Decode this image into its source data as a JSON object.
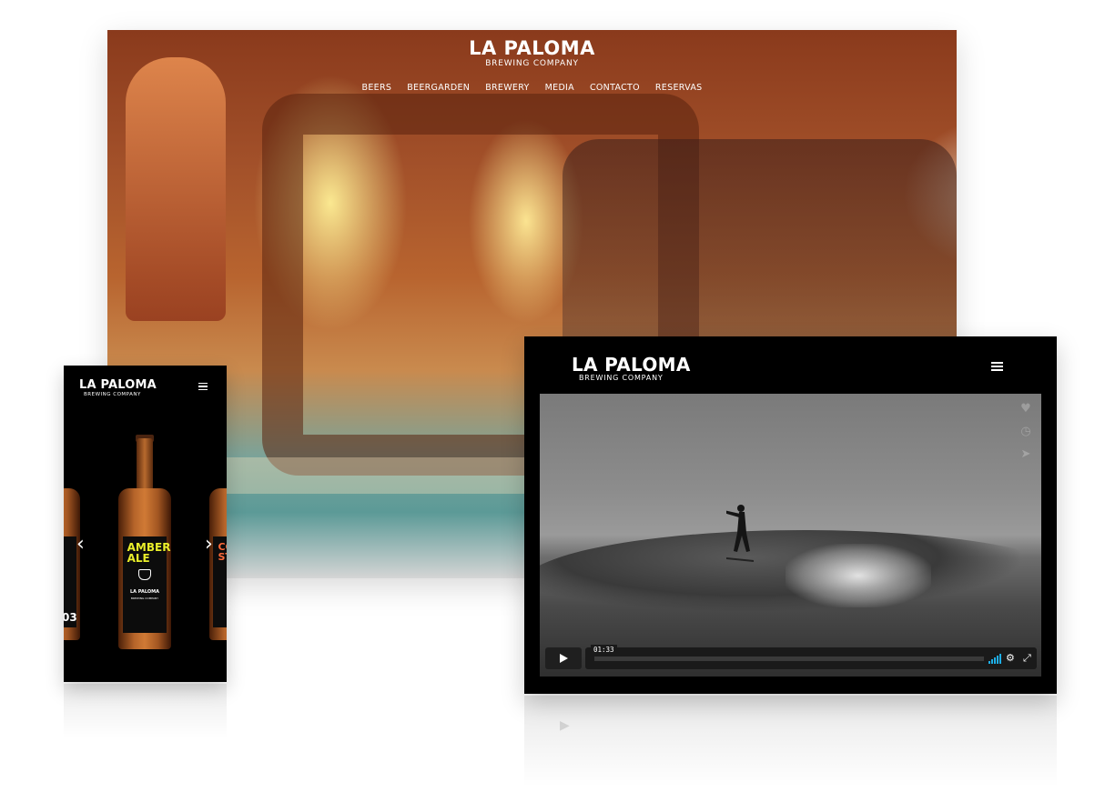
{
  "brand": {
    "name": "LA PALOMA",
    "tagline": "BREWING COMPANY"
  },
  "desktop": {
    "nav": [
      "BEERS",
      "BEERGARDEN",
      "BREWERY",
      "MEDIA",
      "CONTACTO",
      "RESERVAS"
    ]
  },
  "phone": {
    "center_beer": {
      "name_line1": "AMBER",
      "name_line2": "ALE",
      "label_brand": "LA PALOMA",
      "label_brand_sub": "BREWING COMPANY"
    },
    "left_partial_text": "03",
    "right_partial_text_line1": "CO",
    "right_partial_text_line2": "ST",
    "prev_arrow": "‹",
    "next_arrow": "›"
  },
  "video": {
    "time": "01:33",
    "progress": 0.0,
    "icons": [
      "heart-icon",
      "clock-icon",
      "send-icon"
    ],
    "accent_color": "#1eaee6"
  }
}
